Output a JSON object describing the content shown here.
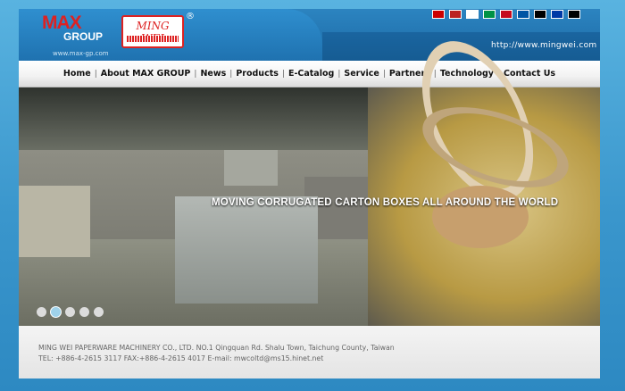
{
  "header": {
    "logo_max_line1": "MAX",
    "logo_max_line2": "GROUP",
    "logo_max_url": "www.max-gp.com",
    "logo_mingwei": "MING WEI",
    "registered": "®",
    "site_url": "http://www.mingwei.com"
  },
  "flags": [
    {
      "name": "taiwan-flag",
      "color": "#c00"
    },
    {
      "name": "usa-flag",
      "color": "#b22"
    },
    {
      "name": "japan-flag",
      "color": "#fff"
    },
    {
      "name": "italy-flag",
      "color": "#009246"
    },
    {
      "name": "spain-flag",
      "color": "#c60b1e"
    },
    {
      "name": "france-flag",
      "color": "#0055a4"
    },
    {
      "name": "germany-flag",
      "color": "#000"
    },
    {
      "name": "russia-flag",
      "color": "#0039a6"
    },
    {
      "name": "afghanistan-flag",
      "color": "#000"
    }
  ],
  "nav": [
    "Home",
    "About MAX GROUP",
    "News",
    "Products",
    "E-Catalog",
    "Service",
    "Partners",
    "Technology",
    "Contact Us"
  ],
  "banner": {
    "tagline": "MOVING CORRUGATED CARTON BOXES ALL AROUND THE WORLD",
    "slides": 5,
    "active_slide": 2
  },
  "footer": {
    "line1": "MING WEI PAPERWARE MACHINERY CO., LTD. NO.1 Qingquan Rd. Shalu Town, Taichung County, Taiwan",
    "line2": "TEL: +886-4-2615 3117 FAX:+886-4-2615 4017   E-mail: mwcoltd@ms15.hinet.net"
  }
}
